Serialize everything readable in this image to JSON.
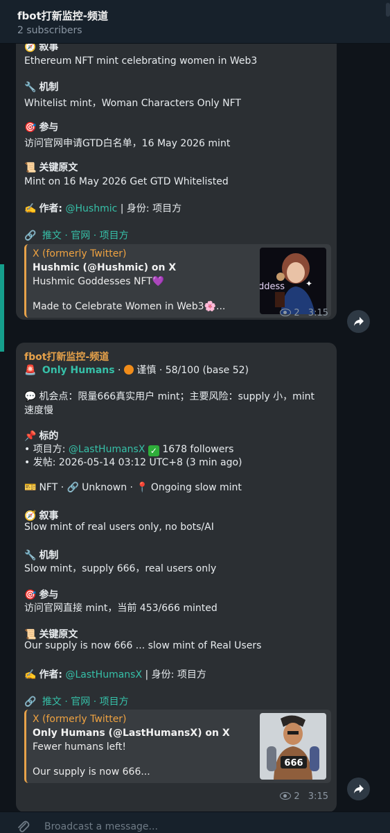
{
  "header": {
    "title": "fbot打新监控-频道",
    "subtitle": "2 subscribers"
  },
  "messages": [
    {
      "narrative_label": "叙事",
      "narrative_text": "Ethereum NFT mint celebrating women in Web3",
      "mechanism_label": "机制",
      "mechanism_text": "Whitelist mint，Woman Characters Only NFT",
      "participate_label": "参与",
      "participate_text": "访问官网申请GTD白名单，16 May 2026 mint",
      "source_label": "关键原文",
      "source_text": "Mint on 16 May 2026 Get GTD Whitelisted",
      "author_label": "作者:",
      "author_handle": "@Hushmic",
      "author_role": "| 身份: 项目方",
      "links": [
        "推文",
        "官网",
        "项目方"
      ],
      "link_sep": "·",
      "preview": {
        "source": "X (formerly Twitter)",
        "title": "Hushmic (@Hushmic) on X",
        "line1": "Hushmic Goddesses NFT💜",
        "line2": "Made to Celebrate Women in Web3🌸..."
      },
      "views": "2",
      "time": "3:15"
    },
    {
      "channel": "fbot打新监控-频道",
      "project_name": "Only Humans",
      "level_text": "谨慎 · 58/100 (base 52)",
      "opportunity": "机会点：限量666真实用户 mint；主要风险：supply 小，mint",
      "opportunity_cont": "速度慢",
      "target_label": "标的",
      "team_prefix": "• 项目方:",
      "team_handle": "@LastHumansX",
      "team_followers": "1678 followers",
      "posted": "• 发帖: 2026-05-14 03:12 UTC+8 (3 min ago)",
      "tags": [
        "NFT",
        "Unknown",
        "Ongoing slow mint"
      ],
      "narrative_label": "叙事",
      "narrative_text": "Slow mint of real users only, no bots/AI",
      "mechanism_label": "机制",
      "mechanism_text": "Slow mint，supply 666，real users only",
      "participate_label": "参与",
      "participate_text": "访问官网直接 mint，当前 453/666 minted",
      "source_label": "关键原文",
      "source_text": "Our supply is now 666 ... slow mint of Real Users",
      "author_label": "作者:",
      "author_handle": "@LastHumansX",
      "author_role": "| 身份: 项目方",
      "links": [
        "推文",
        "官网",
        "项目方"
      ],
      "link_sep": "·",
      "preview": {
        "source": "X (formerly Twitter)",
        "title": "Only Humans (@LastHumansX) on X",
        "line1": "Fewer humans left!",
        "line2": "Our supply is now 666..."
      },
      "views": "2",
      "time": "3:15"
    }
  ],
  "composer": {
    "placeholder": "Broadcast a message..."
  },
  "colors": {
    "accent_link": "#36c0a8",
    "channel_name": "#e7a24a",
    "bubble": "#2b2f33",
    "background": "#0f141a"
  }
}
